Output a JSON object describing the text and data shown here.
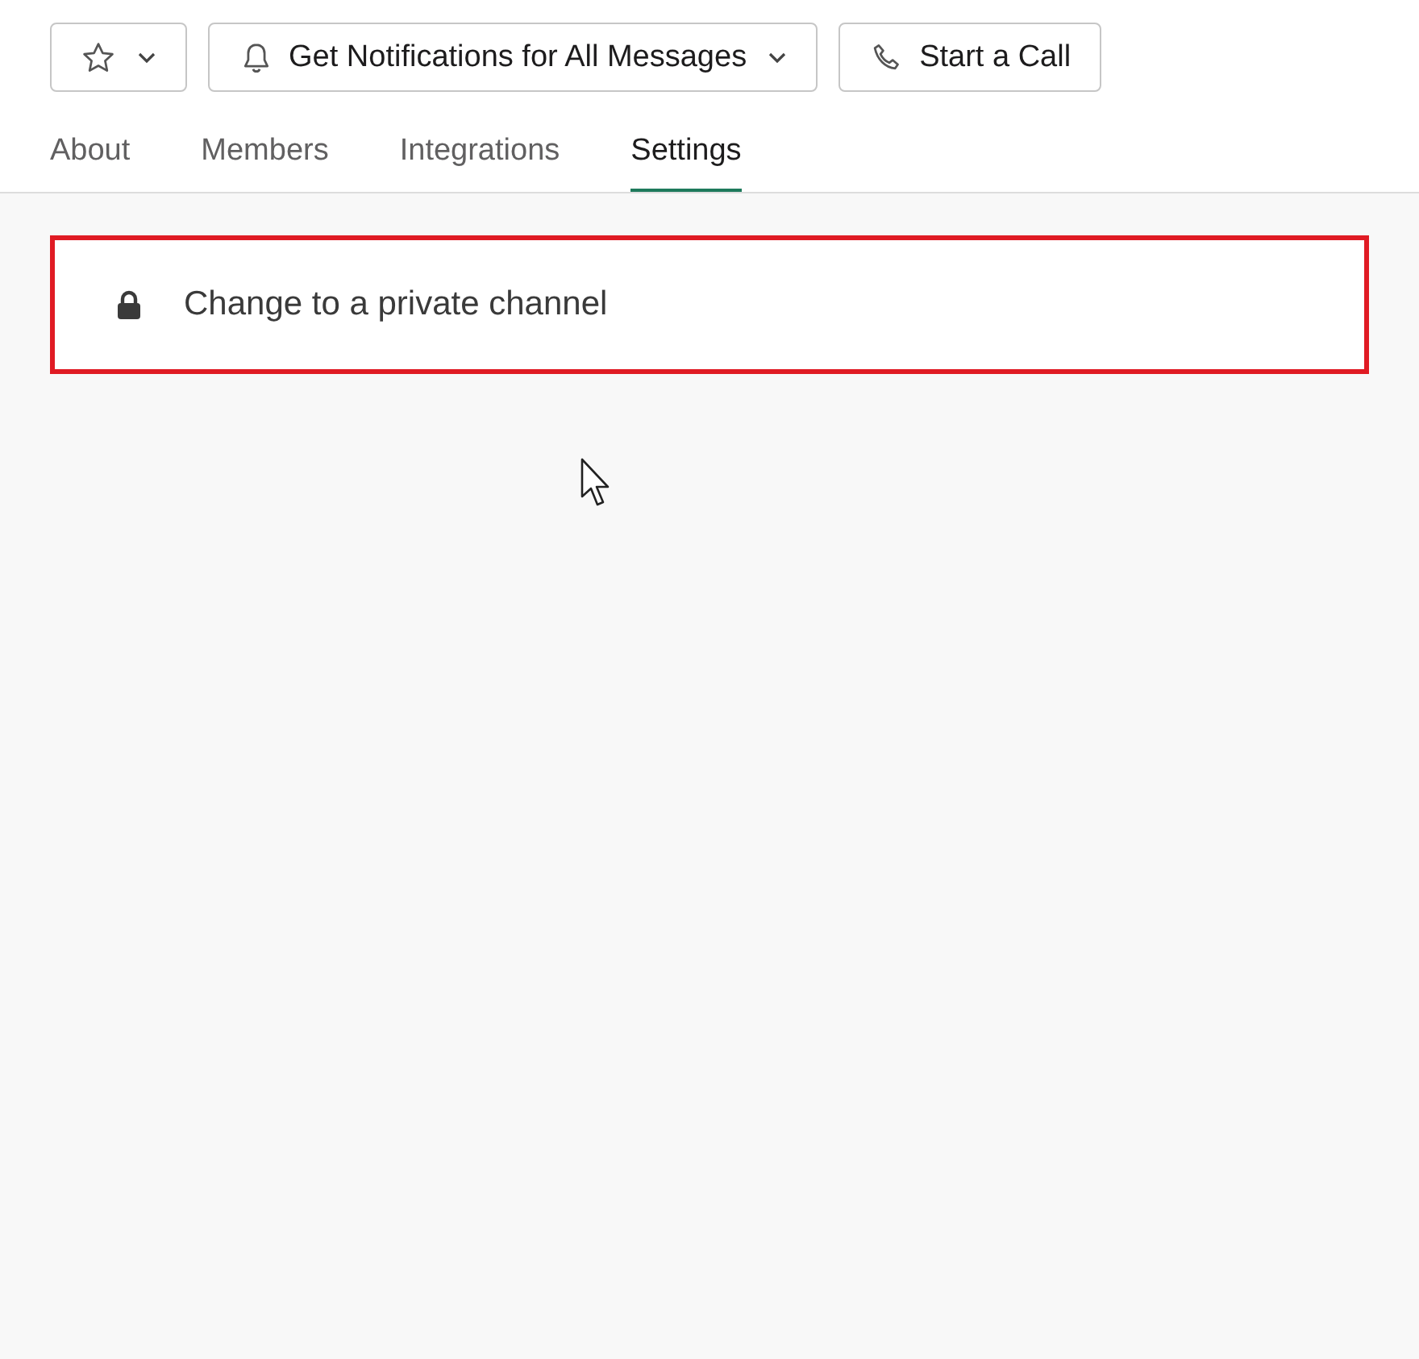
{
  "toolbar": [
    {
      "kind": "star",
      "dropdown": true
    },
    {
      "kind": "notify",
      "label": "Get Notifications for All Messages",
      "dropdown": true
    },
    {
      "kind": "call",
      "label": "Start a Call",
      "dropdown": false
    }
  ],
  "tabs": [
    {
      "label": "About",
      "selected": false
    },
    {
      "label": "Members",
      "selected": false
    },
    {
      "label": "Integrations",
      "selected": false
    },
    {
      "label": "Settings",
      "selected": true
    }
  ],
  "settings_items": [
    {
      "kind": "lock",
      "label": "Change to a private channel",
      "highlighted": true
    }
  ]
}
